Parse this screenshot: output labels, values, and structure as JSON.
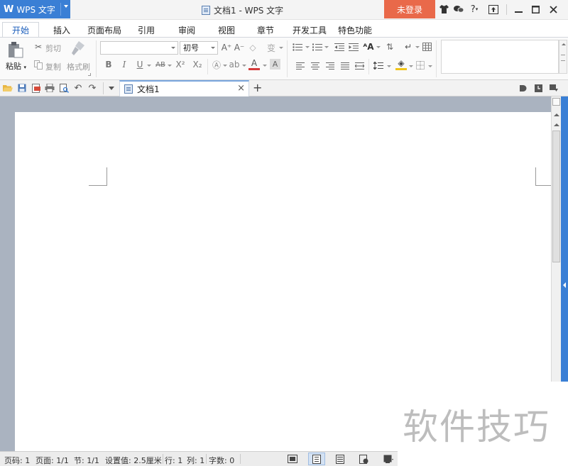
{
  "app": {
    "name": "WPS 文字",
    "logo_letter": "W"
  },
  "window": {
    "title": "文档1 - WPS 文字",
    "login_label": "未登录",
    "help_glyph": "?"
  },
  "tabs": [
    "开始",
    "插入",
    "页面布局",
    "引用",
    "审阅",
    "视图",
    "章节",
    "开发工具",
    "特色功能"
  ],
  "clipboard": {
    "paste": "粘贴",
    "cut": "剪切",
    "copy": "复制",
    "format_painter": "格式刷"
  },
  "font": {
    "family_value": "",
    "size_value": "初号"
  },
  "format_buttons": {
    "bold": "B",
    "italic": "I",
    "underline": "U",
    "strike": "AB",
    "superscript": "X²",
    "subscript": "X₂",
    "font_color": "A",
    "char_shade": "A",
    "grow": "A⁺",
    "shrink": "A⁻",
    "phonetic": "变"
  },
  "document_tab": {
    "name": "文档1",
    "close": "×",
    "new": "+"
  },
  "status": {
    "page_number": "页码: 1",
    "page": "页面: 1/1",
    "section": "节: 1/1",
    "setting": "设置值: 2.5厘米",
    "row": "行: 1",
    "column": "列: 1",
    "word_count": "字数: 0"
  },
  "watermark": "软件技巧",
  "colors": {
    "accent": "#3a7fd5",
    "login_bg": "#e9694a",
    "workspace": "#aab3c0"
  }
}
